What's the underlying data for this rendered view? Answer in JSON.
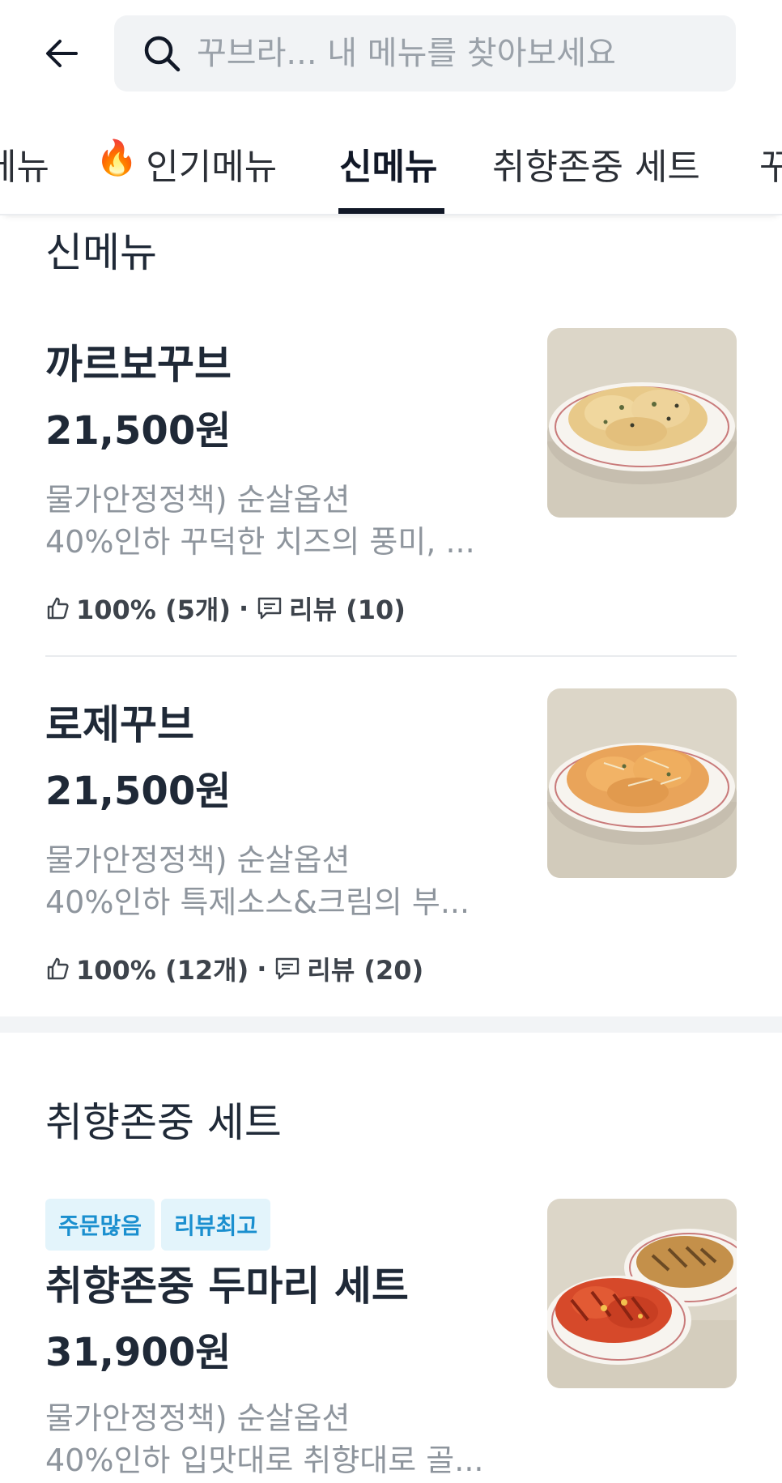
{
  "header": {
    "search_placeholder": "꾸브라... 내 메뉴를 찾아보세요",
    "back_icon": "arrow-left-icon",
    "search_icon": "search-icon"
  },
  "tabs": [
    {
      "label": "메뉴"
    },
    {
      "label": "인기메뉴",
      "icon": "fire-icon"
    },
    {
      "label": "신메뉴",
      "active": true
    },
    {
      "label": "취향존중 세트"
    },
    {
      "label": "꾸"
    }
  ],
  "sections": [
    {
      "title": "신메뉴",
      "items": [
        {
          "name": "까르보꾸브",
          "price": "21,500원",
          "desc_line1": "물가안정정책) 순살옵션",
          "desc_line2": "40%인하 꾸덕한 치즈의 풍미, ...",
          "rating": "100% (5개)",
          "reviews": "리뷰 (10)"
        },
        {
          "name": "로제꾸브",
          "price": "21,500원",
          "desc_line1": "물가안정정책) 순살옵션",
          "desc_line2": "40%인하 특제소스&크림의 부...",
          "rating": "100% (12개)",
          "reviews": "리뷰 (20)"
        }
      ]
    },
    {
      "title": "취향존중 세트",
      "items": [
        {
          "badges": [
            "주문많음",
            "리뷰최고"
          ],
          "name": "취향존중 두마리 세트",
          "price": "31,900원",
          "desc_line1": "물가안정정책) 순살옵션",
          "desc_line2": "40%인하 입맛대로 취향대로 골..."
        }
      ]
    }
  ],
  "colors": {
    "accent_dark": "#111827",
    "muted_text": "#8e959d",
    "badge_bg": "#e3f4fb",
    "badge_text": "#1a8fcf"
  }
}
